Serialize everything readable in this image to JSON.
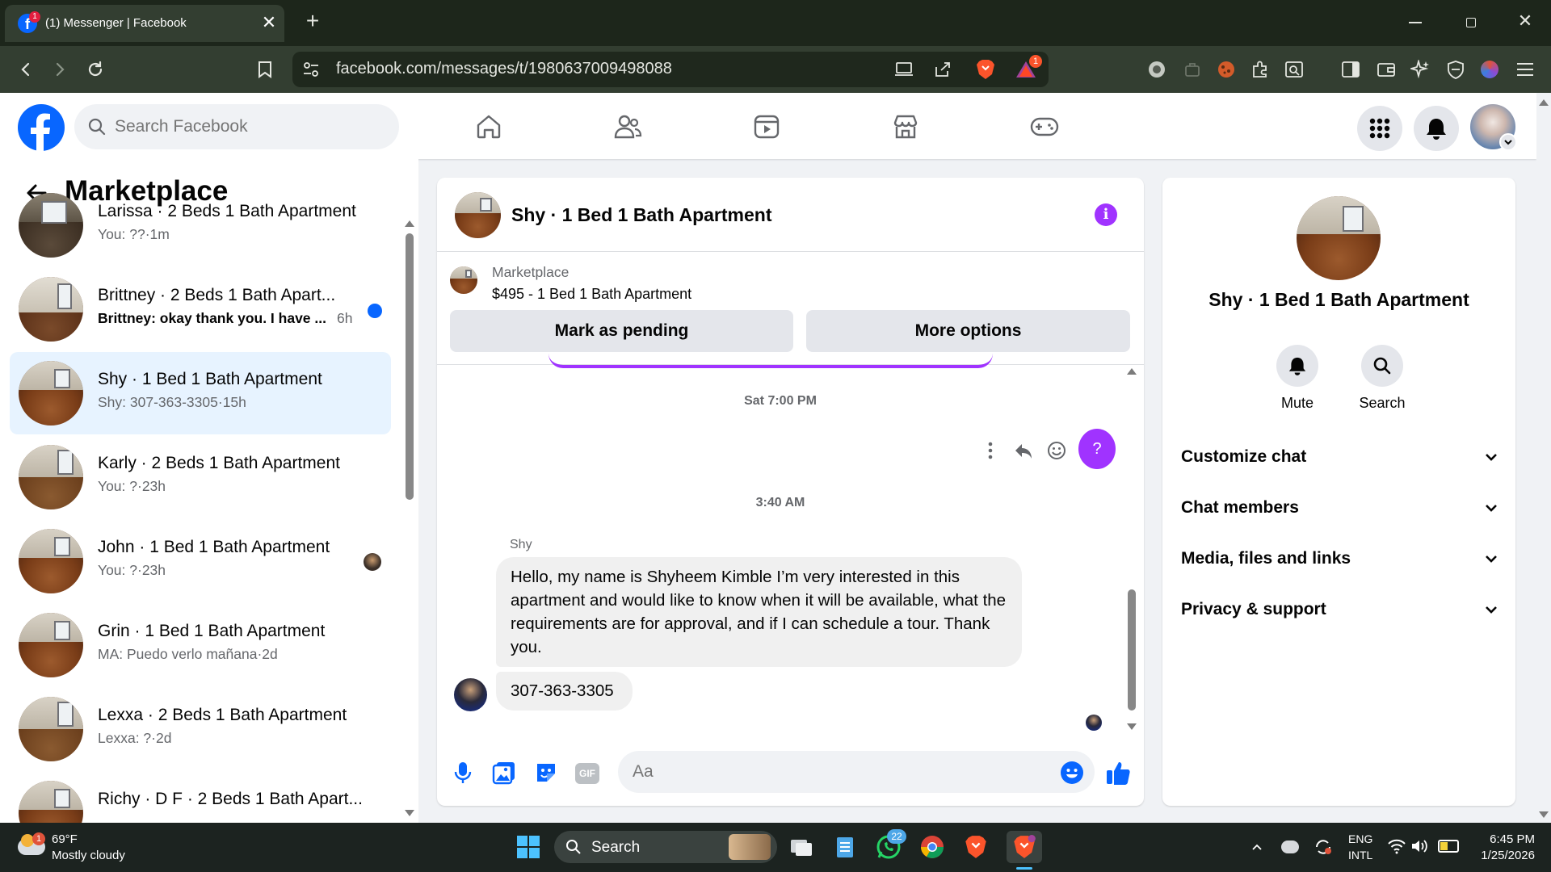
{
  "browser": {
    "tab_title": "(1) Messenger | Facebook",
    "tab_badge": "1",
    "url": "facebook.com/messages/t/1980637009498088",
    "brave_rewards_badge": "1",
    "colors": {
      "tabbar": "#1d261b",
      "toolbar": "#333e31",
      "accent_brave": "#fb542b"
    }
  },
  "facebook_header": {
    "search_placeholder": "Search Facebook",
    "nav_icons": [
      "home-icon",
      "friends-icon",
      "video-icon",
      "marketplace-icon",
      "gaming-icon"
    ],
    "right_icons": [
      "menu-grid-icon",
      "bell-icon",
      "profile-avatar"
    ],
    "brand_color": "#0866ff"
  },
  "left_panel": {
    "title": "Marketplace",
    "conversations": [
      {
        "title": "Larissa · 2 Beds 1 Bath Apartment",
        "subtitle": "You: ??·1m",
        "unread": false
      },
      {
        "title": "Brittney · 2 Beds 1 Bath Apart...",
        "subtitle": "Brittney: okay thank you. I have ...",
        "time": "6h",
        "unread": true
      },
      {
        "title": "Shy · 1 Bed 1 Bath Apartment",
        "subtitle": "Shy: 307-363-3305·15h",
        "unread": false,
        "active": true
      },
      {
        "title": "Karly · 2 Beds 1 Bath Apartment",
        "subtitle": "You: ?·23h",
        "unread": false
      },
      {
        "title": "John · 1 Bed 1 Bath Apartment",
        "subtitle": "You: ?·23h",
        "unread": false,
        "seen_avatar": true
      },
      {
        "title": "Grin · 1 Bed 1 Bath Apartment",
        "subtitle": "MA: Puedo verlo mañana·2d",
        "unread": false
      },
      {
        "title": "Lexxa · 2 Beds 1 Bath Apartment",
        "subtitle": "Lexxa: ?·2d",
        "unread": false
      },
      {
        "title": "Richy · D F · 2 Beds 1 Bath Apart...",
        "subtitle": "",
        "unread": false
      }
    ]
  },
  "chat": {
    "title": "Shy · 1 Bed 1 Bath Apartment",
    "listing": {
      "label": "Marketplace",
      "price_title": "$495 - 1 Bed 1 Bath Apartment",
      "mark_pending": "Mark as pending",
      "more_options": "More options"
    },
    "timestamp1": "Sat 7:00 PM",
    "outgoing_message": "?",
    "timestamp2": "3:40 AM",
    "sender_name": "Shy",
    "message1": "Hello, my name is Shyheem Kimble I’m very interested in this apartment and would like to know when it will be available, what the requirements are for approval, and if I can schedule a tour. Thank you.",
    "message2": "307-363-3305",
    "composer_placeholder": "Aa",
    "accent_color": "#a033ff"
  },
  "right_panel": {
    "title": "Shy · 1 Bed 1 Bath Apartment",
    "mute_label": "Mute",
    "search_label": "Search",
    "sections": [
      "Customize chat",
      "Chat members",
      "Media, files and links",
      "Privacy & support"
    ]
  },
  "taskbar": {
    "weather_temp": "69°F",
    "weather_desc": "Mostly cloudy",
    "weather_badge": "1",
    "search_label": "Search",
    "whatsapp_badge": "22",
    "lang_line1": "ENG",
    "lang_line2": "INTL",
    "time": "6:45 PM",
    "date": "1/25/2026"
  }
}
